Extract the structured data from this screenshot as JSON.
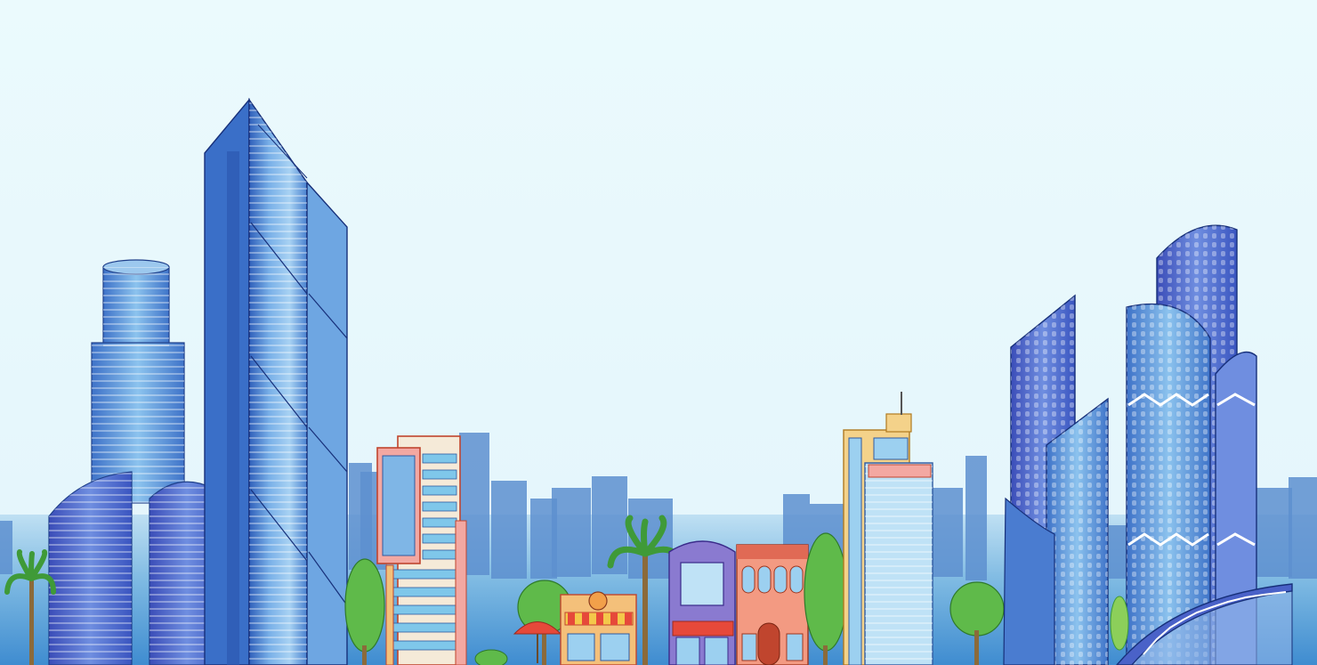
{
  "scene": {
    "colors": {
      "sky_top": "#ebfafd",
      "sky_bottom": "#e4f6fb",
      "ground_band": "#5ea8d8",
      "skyline_far": "#7fa9d6",
      "skyline_mid": "#4f7fc4",
      "glass_blue": "#4f8fd6",
      "glass_light": "#9cc8ee",
      "glass_dark": "#2e58b0",
      "tree_green": "#5fba4a",
      "tree_dark": "#3f9a38",
      "brick_red": "#e06a55",
      "purple": "#8a7ad0",
      "orange": "#f2a04a",
      "yellow": "#f4c84a"
    }
  }
}
